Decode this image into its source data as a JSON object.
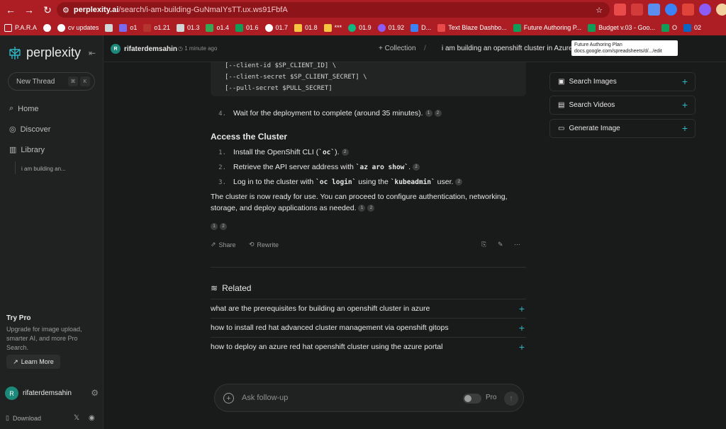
{
  "browser": {
    "url_host": "perplexity.ai",
    "url_path": "/search/i-am-building-GuNmaIYsTT.ux.ws91FbfA",
    "bookmarks": [
      "P.A.R.A",
      "cv updates",
      "o1",
      "o1.21",
      "01.3",
      "o1.4",
      "01.6",
      "01.7",
      "01.8",
      "***",
      "01.9",
      "01.92",
      "D...",
      "Text Blaze Dashbo...",
      "Future Authoring P...",
      "Budget v.03 - Goo...",
      "O",
      "02"
    ],
    "tooltip_title": "Future Authoring Plan",
    "tooltip_url": "docs.google.com/spreadsheets/d/.../edit"
  },
  "sidebar": {
    "brand": "perplexity",
    "new_thread": "New Thread",
    "kbd1": "⌘",
    "kbd2": "K",
    "nav": [
      "Home",
      "Discover",
      "Library"
    ],
    "library_item": "i am building an...",
    "try_pro_title": "Try Pro",
    "try_pro_desc": "Upgrade for image upload, smarter AI, and more Pro Search.",
    "learn_more": "Learn More",
    "username": "rifaterdemsahin",
    "avatar_letter": "R",
    "download": "Download"
  },
  "header": {
    "username": "rifaterdemsahin",
    "avatar_letter": "R",
    "time": "1 minute ago",
    "collection": "+ Collection",
    "thread_title": "i am building an openshift cluster in Azure"
  },
  "answer": {
    "code_lines": [
      "[--client-id $SP_CLIENT_ID] \\",
      "[--client-secret $SP_CLIENT_SECRET] \\",
      "[--pull-secret $PULL_SECRET]"
    ],
    "step4": "Wait for the deployment to complete (around 35 minutes).",
    "heading": "Access the Cluster",
    "s1_pre": "Install the OpenShift CLI (",
    "s1_code": "`oc`",
    "s1_post": ").",
    "s2_pre": "Retrieve the API server address with ",
    "s2_code": "`az aro show`",
    "s2_post": ".",
    "s3_pre": "Log in to the cluster with ",
    "s3_code": "`oc login`",
    "s3_mid": " using the ",
    "s3_code2": "`kubeadmin`",
    "s3_post": " user.",
    "conclusion": "The cluster is now ready for use. You can proceed to configure authentication, networking, storage, and deploy applications as needed.",
    "share": "Share",
    "rewrite": "Rewrite"
  },
  "related": {
    "title": "Related",
    "items": [
      "what are the prerequisites for building an openshift cluster in azure",
      "how to install red hat advanced cluster management via openshift gitops",
      "how to deploy an azure red hat openshift cluster using the azure portal"
    ]
  },
  "side_panel": [
    "Search Images",
    "Search Videos",
    "Generate Image"
  ],
  "followup": {
    "placeholder": "Ask follow-up",
    "pro_label": "Pro"
  }
}
